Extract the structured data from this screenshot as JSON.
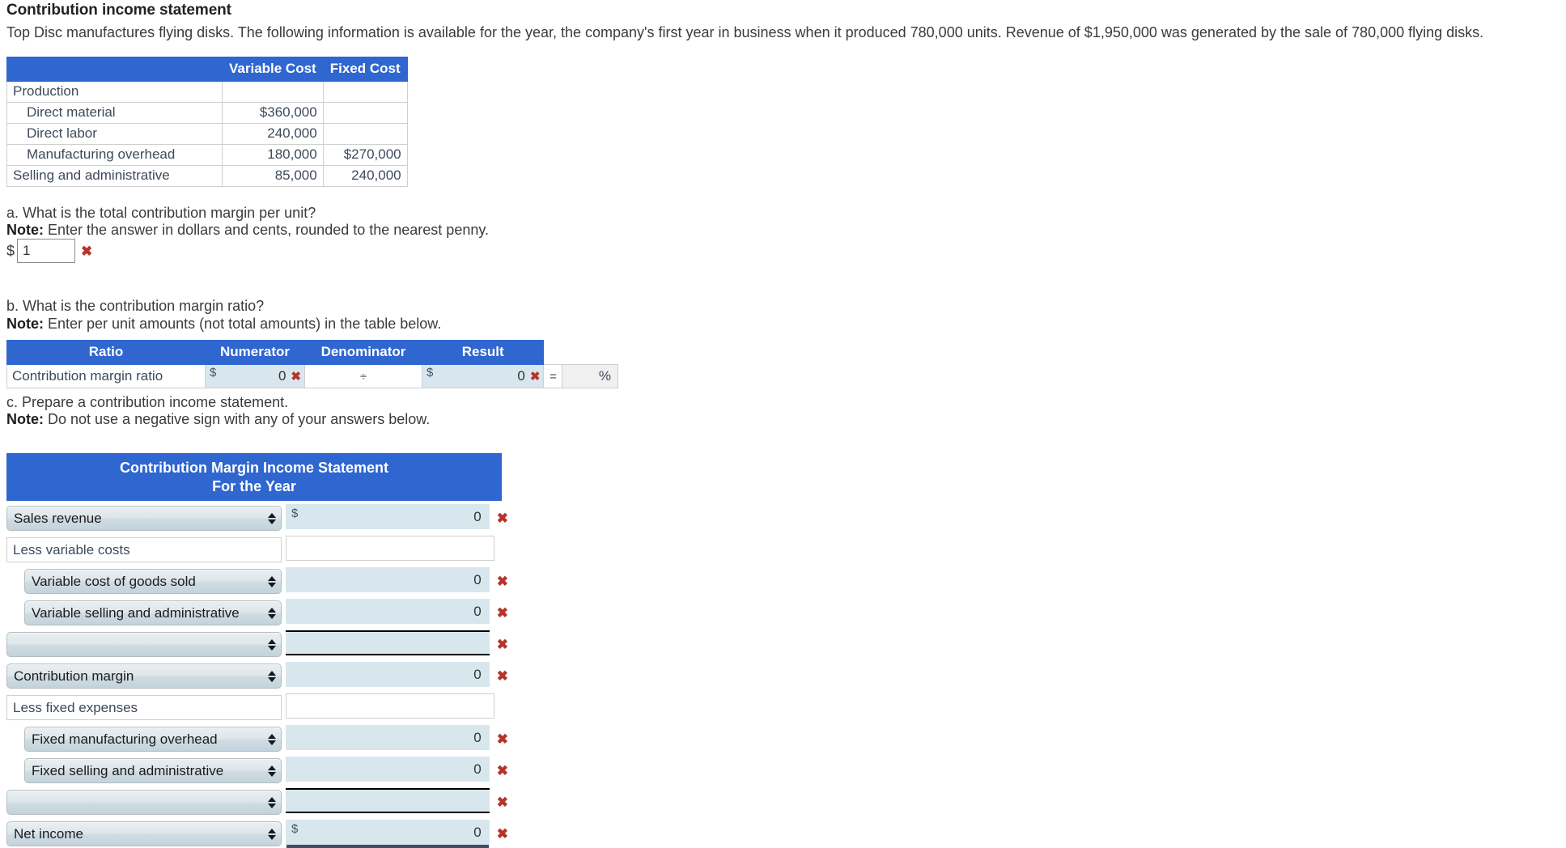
{
  "page": {
    "title": "Contribution income statement",
    "intro": "Top Disc manufactures flying disks. The following information is available for the year, the company's first year in business when it produced 780,000 units. Revenue of $1,950,000 was generated by the sale of 780,000 flying disks."
  },
  "colors": {
    "header_blue": "#2f66cf",
    "field_blue": "#d8e7ee",
    "error_red": "#b5342a",
    "result_gray": "#f0f0f0"
  },
  "cost_table": {
    "headers": [
      "",
      "Variable Cost",
      "Fixed Cost"
    ],
    "rows": [
      {
        "label": "Production",
        "indent": false,
        "variable": "",
        "fixed": ""
      },
      {
        "label": "Direct material",
        "indent": true,
        "variable": "$360,000",
        "fixed": ""
      },
      {
        "label": "Direct labor",
        "indent": true,
        "variable": "240,000",
        "fixed": ""
      },
      {
        "label": "Manufacturing overhead",
        "indent": true,
        "variable": "180,000",
        "fixed": "$270,000"
      },
      {
        "label": "Selling and administrative",
        "indent": false,
        "variable": "85,000",
        "fixed": "240,000"
      }
    ]
  },
  "part_a": {
    "question": "a. What is the total contribution margin per unit?",
    "note_label": "Note:",
    "note_text": " Enter the answer in dollars and cents, rounded to the nearest penny.",
    "dollar_sign": "$",
    "answer_value": "1",
    "answer_placeholder": "",
    "error_icon": "✖"
  },
  "part_b": {
    "question": "b. What is the contribution margin ratio?",
    "note_label": "Note:",
    "note_text": " Enter per unit amounts (not total amounts) in the table below.",
    "headers": [
      "Ratio",
      "Numerator",
      "Denominator",
      "Result"
    ],
    "row_label": "Contribution margin ratio",
    "numerator_prefix": "$",
    "numerator_value": "0",
    "divide_op": "÷",
    "denominator_prefix": "$",
    "denominator_value": "0",
    "equals_op": "=",
    "result_value": "",
    "result_suffix": "%",
    "error_icon": "✖"
  },
  "part_c": {
    "question": "c. Prepare a contribution income statement.",
    "note_label": "Note:",
    "note_text": " Do not use a negative sign with any of your answers below.",
    "statement_title_line1": "Contribution Margin Income Statement",
    "statement_title_line2": "For the Year",
    "error_icon": "✖",
    "rows": [
      {
        "type": "select",
        "label": "Sales revenue",
        "indent": false,
        "prefix": "$",
        "value": "0",
        "error": true,
        "line": "none"
      },
      {
        "type": "text",
        "label": "Less variable costs",
        "indent": false,
        "prefix": "",
        "value": "",
        "error": false,
        "line": "none"
      },
      {
        "type": "select",
        "label": "Variable cost of goods sold",
        "indent": true,
        "prefix": "",
        "value": "0",
        "error": true,
        "line": "none"
      },
      {
        "type": "select",
        "label": "Variable selling and administrative",
        "indent": true,
        "prefix": "",
        "value": "0",
        "error": true,
        "line": "none"
      },
      {
        "type": "select",
        "label": "",
        "indent": false,
        "prefix": "",
        "value": "",
        "error": true,
        "line": "both"
      },
      {
        "type": "select",
        "label": "Contribution margin",
        "indent": false,
        "prefix": "",
        "value": "0",
        "error": true,
        "line": "none"
      },
      {
        "type": "text",
        "label": "Less fixed expenses",
        "indent": false,
        "prefix": "",
        "value": "",
        "error": false,
        "line": "none"
      },
      {
        "type": "select",
        "label": "Fixed manufacturing overhead",
        "indent": true,
        "prefix": "",
        "value": "0",
        "error": true,
        "line": "none"
      },
      {
        "type": "select",
        "label": "Fixed selling and administrative",
        "indent": true,
        "prefix": "",
        "value": "0",
        "error": true,
        "line": "none"
      },
      {
        "type": "select",
        "label": "",
        "indent": false,
        "prefix": "",
        "value": "",
        "error": true,
        "line": "both"
      },
      {
        "type": "select",
        "label": "Net income",
        "indent": false,
        "prefix": "$",
        "value": "0",
        "error": true,
        "line": "double"
      }
    ]
  }
}
